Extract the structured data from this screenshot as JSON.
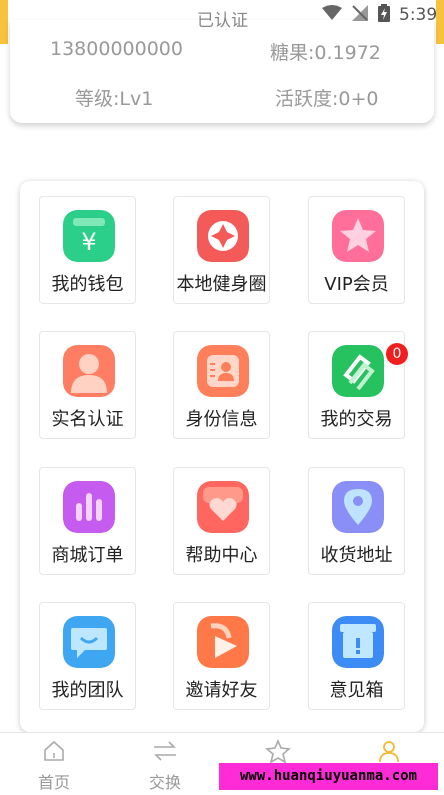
{
  "status_bar": {
    "verified_text": "已认证",
    "time": "5:39"
  },
  "user": {
    "phone": "13800000000",
    "candy": "糖果:0.1972",
    "level": "等级:Lv1",
    "activity": "活跃度:0+0"
  },
  "menu": [
    {
      "label": "我的钱包",
      "icon": "wallet-icon",
      "color": "#2ccf8a"
    },
    {
      "label": "本地健身圈",
      "icon": "fitness-icon",
      "color": "#f45a58"
    },
    {
      "label": "VIP会员",
      "icon": "vip-star-icon",
      "color": "#ff6f9a"
    },
    {
      "label": "实名认证",
      "icon": "person-icon",
      "color": "#ff7d63"
    },
    {
      "label": "身份信息",
      "icon": "id-card-icon",
      "color": "#ff7f5b"
    },
    {
      "label": "我的交易",
      "icon": "transaction-icon",
      "color": "#25c25f",
      "badge": "0"
    },
    {
      "label": "商城订单",
      "icon": "order-chart-icon",
      "color": "#c65bef"
    },
    {
      "label": "帮助中心",
      "icon": "heart-help-icon",
      "color": "#ff6660"
    },
    {
      "label": "收货地址",
      "icon": "location-pin-icon",
      "color": "#8a8ff7"
    },
    {
      "label": "我的团队",
      "icon": "team-chat-icon",
      "color": "#3fa6f2"
    },
    {
      "label": "邀请好友",
      "icon": "invite-play-icon",
      "color": "#ff7847"
    },
    {
      "label": "意见箱",
      "icon": "feedback-box-icon",
      "color": "#3d8cf5"
    }
  ],
  "tabs": [
    {
      "label": "首页",
      "icon": "home-icon"
    },
    {
      "label": "交换",
      "icon": "exchange-icon"
    },
    {
      "label": "",
      "icon": "star-icon"
    },
    {
      "label": "",
      "icon": "profile-icon"
    }
  ],
  "watermark": "www.huanqiuyuanma.com"
}
